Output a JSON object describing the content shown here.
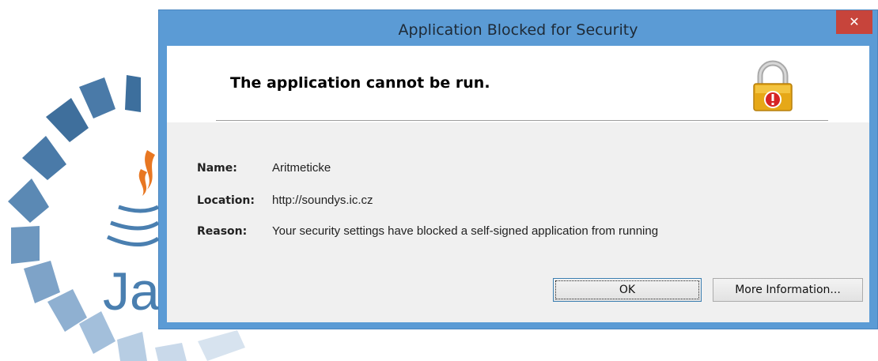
{
  "dialog": {
    "title": "Application Blocked for Security",
    "close_label": "✕",
    "header": "The application cannot be run.",
    "fields": [
      {
        "label": "Name:",
        "value": "Aritmeticke"
      },
      {
        "label": "Location:",
        "value": "http://soundys.ic.cz"
      },
      {
        "label": "Reason:",
        "value": "Your security settings have blocked a self-signed application from running"
      }
    ],
    "buttons": {
      "ok": "OK",
      "more_info": "More Information..."
    }
  },
  "splash": {
    "logo_text": "Jav",
    "colors": {
      "ring": "#3d6f9d",
      "cup": "#e87722",
      "logo_blue": "#4a7fb0"
    }
  },
  "icons": {
    "lock": "lock-warning-icon",
    "close": "close-icon"
  }
}
